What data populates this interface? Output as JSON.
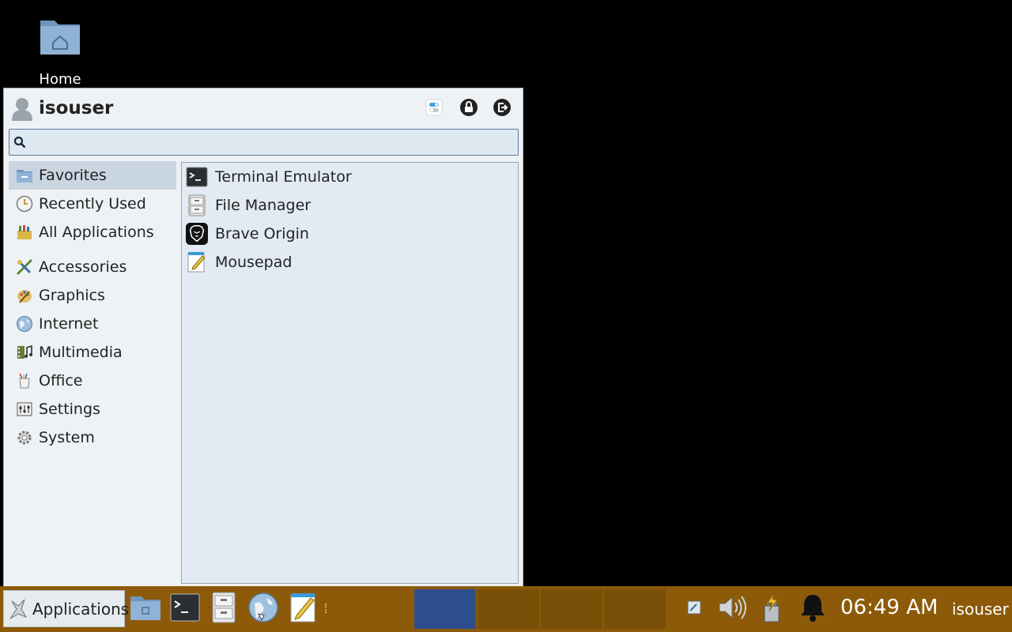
{
  "desktop": {
    "home_label": "Home"
  },
  "menu": {
    "username": "isouser",
    "search_placeholder": "",
    "categories": [
      {
        "label": "Favorites",
        "icon": "favorites-icon"
      },
      {
        "label": "Recently Used",
        "icon": "clock-icon"
      },
      {
        "label": "All Applications",
        "icon": "all-apps-icon"
      },
      {
        "label": "Accessories",
        "icon": "accessories-icon"
      },
      {
        "label": "Graphics",
        "icon": "graphics-icon"
      },
      {
        "label": "Internet",
        "icon": "globe-icon"
      },
      {
        "label": "Multimedia",
        "icon": "multimedia-icon"
      },
      {
        "label": "Office",
        "icon": "office-icon"
      },
      {
        "label": "Settings",
        "icon": "settings-icon"
      },
      {
        "label": "System",
        "icon": "gear-icon"
      }
    ],
    "apps": [
      {
        "label": "Terminal Emulator",
        "icon": "terminal-icon"
      },
      {
        "label": "File Manager",
        "icon": "file-cabinet-icon"
      },
      {
        "label": "Brave Origin",
        "icon": "brave-lion-icon"
      },
      {
        "label": "Mousepad",
        "icon": "notepad-icon"
      }
    ]
  },
  "taskbar": {
    "applications_label": "Applications",
    "clock": "06:49 AM",
    "user": "isouser"
  },
  "colors": {
    "taskbar": "#8c5a08",
    "active_workspace": "#2e4f8f",
    "menu_bg": "#eef2f5"
  }
}
